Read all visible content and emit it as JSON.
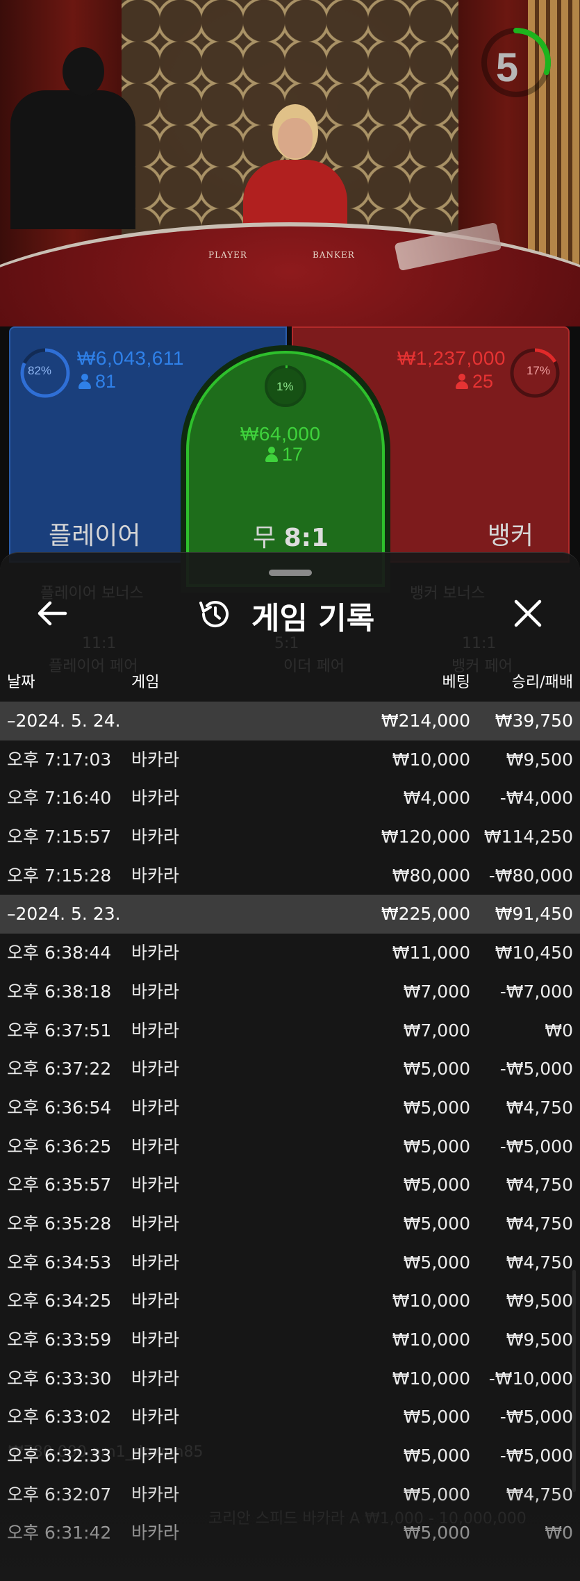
{
  "timer": {
    "value": "5",
    "progress": 0.3
  },
  "table_labels": {
    "player": "PLAYER",
    "banker": "BANKER"
  },
  "bets": {
    "player": {
      "percent": "82%",
      "amount": "₩6,043,611",
      "count": "81",
      "label": "플레이어"
    },
    "tie": {
      "percent": "1%",
      "amount": "₩64,000",
      "count": "17",
      "label": "무",
      "payout": "8:1"
    },
    "banker": {
      "percent": "17%",
      "amount": "₩1,237,000",
      "count": "25",
      "label": "뱅커"
    }
  },
  "colors": {
    "player": "#2f6fd6",
    "tie": "#2ec02c",
    "banker": "#e02a2a",
    "accent": "#1db41d"
  },
  "icons": [
    "back-arrow-icon",
    "history-icon",
    "close-icon",
    "person-icon",
    "timer-icon"
  ],
  "sheet": {
    "title": "게임 기록",
    "columns": {
      "date": "날짜",
      "game": "게임",
      "bet": "베팅",
      "result": "승리/패배"
    },
    "rows": [
      {
        "type": "date",
        "date": "–2024. 5. 24.",
        "game": "",
        "bet": "₩214,000",
        "result": "₩39,750"
      },
      {
        "type": "item",
        "date": "오후 7:17:03",
        "game": "바카라",
        "bet": "₩10,000",
        "result": "₩9,500"
      },
      {
        "type": "item",
        "date": "오후 7:16:40",
        "game": "바카라",
        "bet": "₩4,000",
        "result": "-₩4,000"
      },
      {
        "type": "item",
        "date": "오후 7:15:57",
        "game": "바카라",
        "bet": "₩120,000",
        "result": "₩114,250"
      },
      {
        "type": "item",
        "date": "오후 7:15:28",
        "game": "바카라",
        "bet": "₩80,000",
        "result": "-₩80,000"
      },
      {
        "type": "date",
        "date": "–2024. 5. 23.",
        "game": "",
        "bet": "₩225,000",
        "result": "₩91,450"
      },
      {
        "type": "item",
        "date": "오후 6:38:44",
        "game": "바카라",
        "bet": "₩11,000",
        "result": "₩10,450"
      },
      {
        "type": "item",
        "date": "오후 6:38:18",
        "game": "바카라",
        "bet": "₩7,000",
        "result": "-₩7,000"
      },
      {
        "type": "item",
        "date": "오후 6:37:51",
        "game": "바카라",
        "bet": "₩7,000",
        "result": "₩0"
      },
      {
        "type": "item",
        "date": "오후 6:37:22",
        "game": "바카라",
        "bet": "₩5,000",
        "result": "-₩5,000"
      },
      {
        "type": "item",
        "date": "오후 6:36:54",
        "game": "바카라",
        "bet": "₩5,000",
        "result": "₩4,750"
      },
      {
        "type": "item",
        "date": "오후 6:36:25",
        "game": "바카라",
        "bet": "₩5,000",
        "result": "-₩5,000"
      },
      {
        "type": "item",
        "date": "오후 6:35:57",
        "game": "바카라",
        "bet": "₩5,000",
        "result": "₩4,750"
      },
      {
        "type": "item",
        "date": "오후 6:35:28",
        "game": "바카라",
        "bet": "₩5,000",
        "result": "₩4,750"
      },
      {
        "type": "item",
        "date": "오후 6:34:53",
        "game": "바카라",
        "bet": "₩5,000",
        "result": "₩4,750"
      },
      {
        "type": "item",
        "date": "오후 6:34:25",
        "game": "바카라",
        "bet": "₩10,000",
        "result": "₩9,500"
      },
      {
        "type": "item",
        "date": "오후 6:33:59",
        "game": "바카라",
        "bet": "₩10,000",
        "result": "₩9,500"
      },
      {
        "type": "item",
        "date": "오후 6:33:30",
        "game": "바카라",
        "bet": "₩10,000",
        "result": "-₩10,000"
      },
      {
        "type": "item",
        "date": "오후 6:33:02",
        "game": "바카라",
        "bet": "₩5,000",
        "result": "-₩5,000"
      },
      {
        "type": "item",
        "date": "오후 6:32:33",
        "game": "바카라",
        "bet": "₩5,000",
        "result": "-₩5,000"
      },
      {
        "type": "item",
        "date": "오후 6:32:07",
        "game": "바카라",
        "bet": "₩5,000",
        "result": "₩4,750"
      },
      {
        "type": "item",
        "date": "오후 6:31:42",
        "game": "바카라",
        "bet": "₩5,000",
        "result": "₩0"
      }
    ]
  },
  "background_ghost": {
    "player_bonus": "플레이어 보너스",
    "either_pair": "5:1",
    "banker_bonus": "뱅커 보너스",
    "player_pair_odds": "11:1",
    "player_pair": "플레이어 페어",
    "either_pair_label": "이더 페어",
    "banker_pair_odds": "11:1",
    "banker_pair": "뱅커 페어",
    "balance_line": "₩780,000 am1_dowon85",
    "total_line": "코리안 스피드 바카라 A  ₩1,000 - 10,000,000"
  }
}
